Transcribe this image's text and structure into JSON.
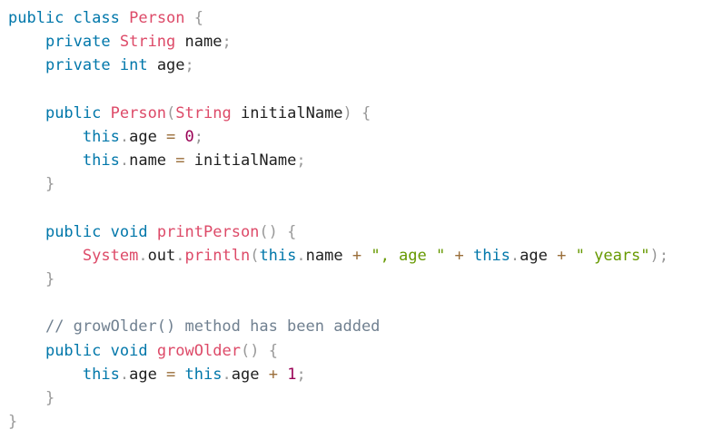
{
  "colors": {
    "keyword": "#0077aa",
    "class_name": "#dd4a68",
    "punctuation": "#999999",
    "plain": "#1f1f1f",
    "number": "#990055",
    "string": "#669900",
    "comment": "#708090",
    "operator": "#9a6e3a"
  },
  "editor": {
    "lines": [
      [
        {
          "t": "public",
          "k": "keyword"
        },
        {
          "t": " ",
          "k": "plain"
        },
        {
          "t": "class",
          "k": "keyword"
        },
        {
          "t": " ",
          "k": "plain"
        },
        {
          "t": "Person",
          "k": "class_name"
        },
        {
          "t": " ",
          "k": "plain"
        },
        {
          "t": "{",
          "k": "punctuation"
        }
      ],
      [
        {
          "t": "    ",
          "k": "plain"
        },
        {
          "t": "private",
          "k": "keyword"
        },
        {
          "t": " ",
          "k": "plain"
        },
        {
          "t": "String",
          "k": "class_name"
        },
        {
          "t": " name",
          "k": "plain"
        },
        {
          "t": ";",
          "k": "punctuation"
        }
      ],
      [
        {
          "t": "    ",
          "k": "plain"
        },
        {
          "t": "private",
          "k": "keyword"
        },
        {
          "t": " ",
          "k": "plain"
        },
        {
          "t": "int",
          "k": "keyword"
        },
        {
          "t": " age",
          "k": "plain"
        },
        {
          "t": ";",
          "k": "punctuation"
        }
      ],
      [],
      [
        {
          "t": "    ",
          "k": "plain"
        },
        {
          "t": "public",
          "k": "keyword"
        },
        {
          "t": " ",
          "k": "plain"
        },
        {
          "t": "Person",
          "k": "class_name"
        },
        {
          "t": "(",
          "k": "punctuation"
        },
        {
          "t": "String",
          "k": "class_name"
        },
        {
          "t": " initialName",
          "k": "plain"
        },
        {
          "t": ")",
          "k": "punctuation"
        },
        {
          "t": " ",
          "k": "plain"
        },
        {
          "t": "{",
          "k": "punctuation"
        }
      ],
      [
        {
          "t": "        ",
          "k": "plain"
        },
        {
          "t": "this",
          "k": "keyword"
        },
        {
          "t": ".",
          "k": "punctuation"
        },
        {
          "t": "age ",
          "k": "plain"
        },
        {
          "t": "=",
          "k": "operator"
        },
        {
          "t": " ",
          "k": "plain"
        },
        {
          "t": "0",
          "k": "number"
        },
        {
          "t": ";",
          "k": "punctuation"
        }
      ],
      [
        {
          "t": "        ",
          "k": "plain"
        },
        {
          "t": "this",
          "k": "keyword"
        },
        {
          "t": ".",
          "k": "punctuation"
        },
        {
          "t": "name ",
          "k": "plain"
        },
        {
          "t": "=",
          "k": "operator"
        },
        {
          "t": " initialName",
          "k": "plain"
        },
        {
          "t": ";",
          "k": "punctuation"
        }
      ],
      [
        {
          "t": "    ",
          "k": "plain"
        },
        {
          "t": "}",
          "k": "punctuation"
        }
      ],
      [],
      [
        {
          "t": "    ",
          "k": "plain"
        },
        {
          "t": "public",
          "k": "keyword"
        },
        {
          "t": " ",
          "k": "plain"
        },
        {
          "t": "void",
          "k": "keyword"
        },
        {
          "t": " ",
          "k": "plain"
        },
        {
          "t": "printPerson",
          "k": "class_name"
        },
        {
          "t": "(",
          "k": "punctuation"
        },
        {
          "t": ")",
          "k": "punctuation"
        },
        {
          "t": " ",
          "k": "plain"
        },
        {
          "t": "{",
          "k": "punctuation"
        }
      ],
      [
        {
          "t": "        ",
          "k": "plain"
        },
        {
          "t": "System",
          "k": "class_name"
        },
        {
          "t": ".",
          "k": "punctuation"
        },
        {
          "t": "out",
          "k": "plain"
        },
        {
          "t": ".",
          "k": "punctuation"
        },
        {
          "t": "println",
          "k": "class_name"
        },
        {
          "t": "(",
          "k": "punctuation"
        },
        {
          "t": "this",
          "k": "keyword"
        },
        {
          "t": ".",
          "k": "punctuation"
        },
        {
          "t": "name ",
          "k": "plain"
        },
        {
          "t": "+",
          "k": "operator"
        },
        {
          "t": " ",
          "k": "plain"
        },
        {
          "t": "\", age \"",
          "k": "string"
        },
        {
          "t": " ",
          "k": "plain"
        },
        {
          "t": "+",
          "k": "operator"
        },
        {
          "t": " ",
          "k": "plain"
        },
        {
          "t": "this",
          "k": "keyword"
        },
        {
          "t": ".",
          "k": "punctuation"
        },
        {
          "t": "age ",
          "k": "plain"
        },
        {
          "t": "+",
          "k": "operator"
        },
        {
          "t": " ",
          "k": "plain"
        },
        {
          "t": "\" years\"",
          "k": "string"
        },
        {
          "t": ")",
          "k": "punctuation"
        },
        {
          "t": ";",
          "k": "punctuation"
        }
      ],
      [
        {
          "t": "    ",
          "k": "plain"
        },
        {
          "t": "}",
          "k": "punctuation"
        }
      ],
      [],
      [
        {
          "t": "    ",
          "k": "plain"
        },
        {
          "t": "// growOlder() method has been added",
          "k": "comment"
        }
      ],
      [
        {
          "t": "    ",
          "k": "plain"
        },
        {
          "t": "public",
          "k": "keyword"
        },
        {
          "t": " ",
          "k": "plain"
        },
        {
          "t": "void",
          "k": "keyword"
        },
        {
          "t": " ",
          "k": "plain"
        },
        {
          "t": "growOlder",
          "k": "class_name"
        },
        {
          "t": "(",
          "k": "punctuation"
        },
        {
          "t": ")",
          "k": "punctuation"
        },
        {
          "t": " ",
          "k": "plain"
        },
        {
          "t": "{",
          "k": "punctuation"
        }
      ],
      [
        {
          "t": "        ",
          "k": "plain"
        },
        {
          "t": "this",
          "k": "keyword"
        },
        {
          "t": ".",
          "k": "punctuation"
        },
        {
          "t": "age ",
          "k": "plain"
        },
        {
          "t": "=",
          "k": "operator"
        },
        {
          "t": " ",
          "k": "plain"
        },
        {
          "t": "this",
          "k": "keyword"
        },
        {
          "t": ".",
          "k": "punctuation"
        },
        {
          "t": "age ",
          "k": "plain"
        },
        {
          "t": "+",
          "k": "operator"
        },
        {
          "t": " ",
          "k": "plain"
        },
        {
          "t": "1",
          "k": "number"
        },
        {
          "t": ";",
          "k": "punctuation"
        }
      ],
      [
        {
          "t": "    ",
          "k": "plain"
        },
        {
          "t": "}",
          "k": "punctuation"
        }
      ],
      [
        {
          "t": "}",
          "k": "punctuation"
        }
      ]
    ]
  }
}
